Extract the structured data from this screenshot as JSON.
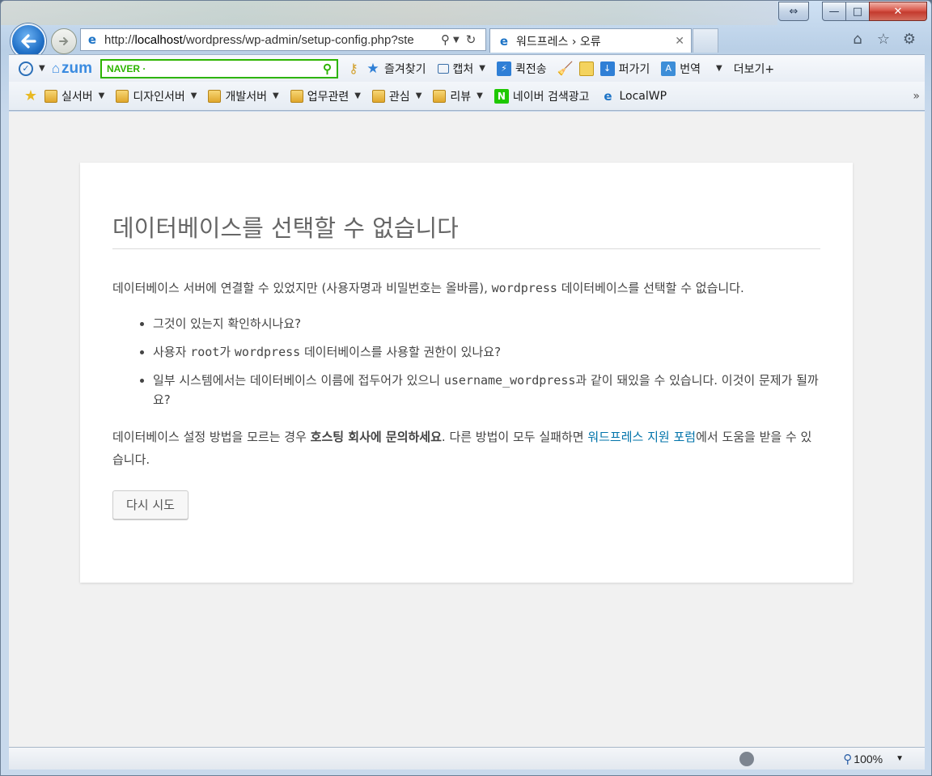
{
  "window": {
    "caption_buttons": {
      "restore": "⇔",
      "minimize": "—",
      "maximize": "□",
      "close": "✕"
    }
  },
  "nav": {
    "address": {
      "prefix": "http://",
      "host": "localhost",
      "path": "/wordpress/wp-admin/setup-config.php?ste"
    },
    "tab_title": "워드프레스 › 오류"
  },
  "toolbar": {
    "naver_placeholder": "NAVER ·",
    "zum_label": "zum",
    "items": [
      {
        "label": "즐겨찾기",
        "icon": "star-icon"
      },
      {
        "label": "캡처",
        "icon": "capture-icon",
        "dropdown": true
      },
      {
        "label": "퀵전송",
        "icon": "quick-send-icon"
      },
      {
        "label": "",
        "icon": "broom-icon"
      },
      {
        "label": "",
        "icon": "memo-icon"
      },
      {
        "label": "퍼가기",
        "icon": "download-icon"
      },
      {
        "label": "번역",
        "icon": "translate-icon",
        "dropdown": true
      },
      {
        "label": "더보기+",
        "icon": ""
      }
    ]
  },
  "favorites": [
    {
      "label": "실서버",
      "dropdown": true
    },
    {
      "label": "디자인서버",
      "dropdown": true
    },
    {
      "label": "개발서버",
      "dropdown": true
    },
    {
      "label": "업무관련",
      "dropdown": true
    },
    {
      "label": "관심",
      "dropdown": true
    },
    {
      "label": "리뷰",
      "dropdown": true
    },
    {
      "label": "네이버 검색광고",
      "dropdown": false,
      "icon": "naver-n-icon"
    },
    {
      "label": "LocalWP",
      "dropdown": false,
      "icon": "ie-page-icon"
    }
  ],
  "content": {
    "title": "데이터베이스를 선택할 수 없습니다",
    "intro_1": "데이터베이스 서버에 연결할 수 있었지만 (사용자명과 비밀번호는 올바름),",
    "intro_db": "wordpress",
    "intro_2": "데이터베이스를 선택할 수 없습니다.",
    "bullet_1": "그것이 있는지 확인하시나요?",
    "bullet_2_a": "사용자",
    "bullet_2_user": "root",
    "bullet_2_b": "가",
    "bullet_2_db": "wordpress",
    "bullet_2_c": "데이터베이스를 사용할 권한이 있나요?",
    "bullet_3_a": "일부 시스템에서는 데이터베이스 이름에 접두어가 있으니",
    "bullet_3_code": "username_wordpress",
    "bullet_3_b": "과 같이 돼있을 수 있습니다. 이것이 문제가 될까요?",
    "help_1": "데이터베이스 설정 방법을 모르는 경우 ",
    "help_bold": "호스팅 회사에 문의하세요",
    "help_2": ". 다른 방법이 모두 실패하면 ",
    "help_link": "워드프레스 지원 포럼",
    "help_3": "에서 도움을 받을 수 있습니다.",
    "retry_button": "다시 시도"
  },
  "statusbar": {
    "zoom": "100%"
  }
}
